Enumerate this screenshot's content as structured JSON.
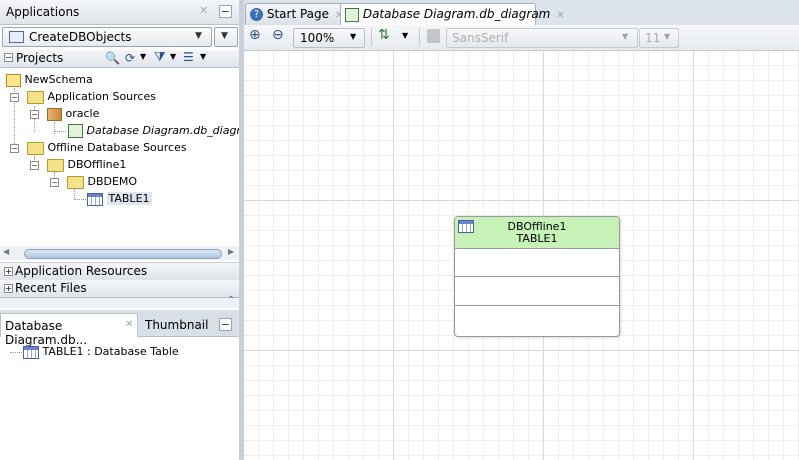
{
  "applications_panel": {
    "title": "Applications",
    "app_selector_value": "CreateDBObjects"
  },
  "projects": {
    "title": "Projects",
    "tree": [
      {
        "label": "NewSchema"
      },
      {
        "label": "Application Sources"
      },
      {
        "label": "oracle"
      },
      {
        "label": "Database Diagram.db_diagram"
      },
      {
        "label": "Offline Database Sources"
      },
      {
        "label": "DBOffline1"
      },
      {
        "label": "DBDEMO"
      },
      {
        "label": "TABLE1"
      }
    ],
    "sections": [
      "Application Resources",
      "Recent Files"
    ]
  },
  "structure_panel": {
    "tabs": [
      "Database Diagram.db...",
      "Thumbnail"
    ],
    "item_label": "TABLE1 : Database Table"
  },
  "editor": {
    "tabs": [
      "Start Page",
      "Database Diagram.db_diagram"
    ],
    "zoom": "100%",
    "font_family": "SansSerif",
    "font_size": "11"
  },
  "diagram": {
    "table_schema": "DBOffline1",
    "table_name": "TABLE1",
    "header_color": "#c6f2b7"
  }
}
